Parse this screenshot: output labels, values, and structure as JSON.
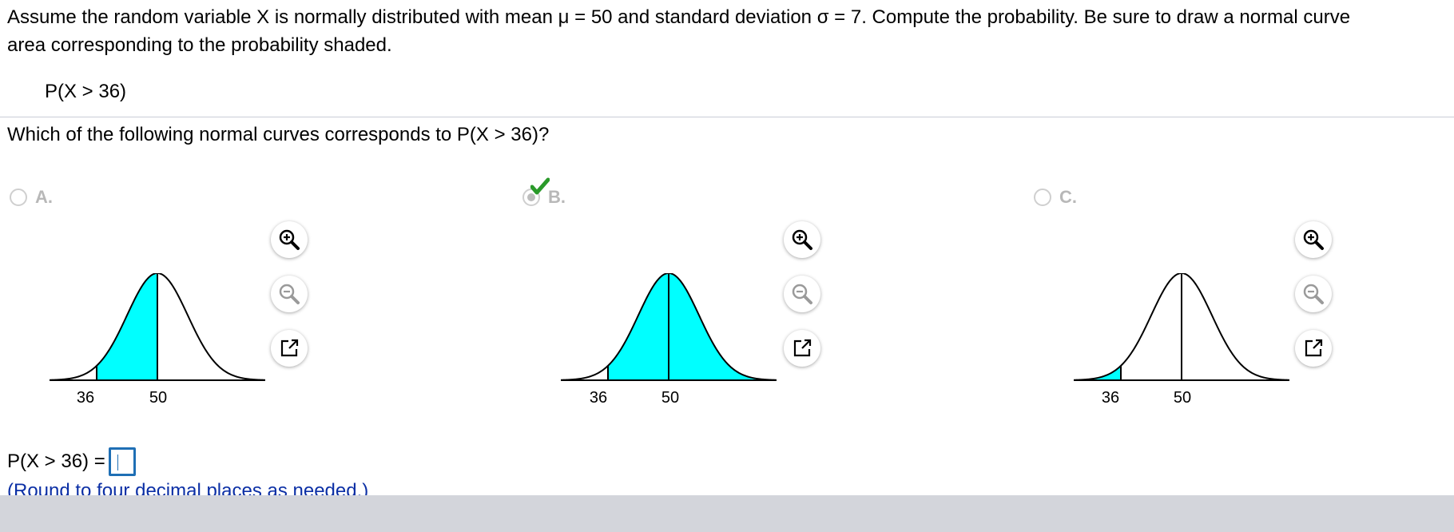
{
  "question": {
    "text_line1": "Assume the random variable X is normally distributed with mean μ = 50 and standard deviation σ = 7. Compute the probability. Be sure to draw a normal curve",
    "text_line2": "area corresponding to the probability shaded.",
    "expression": "P(X > 36)"
  },
  "prompt": "Which of the following normal curves corresponds to P(X > 36)?",
  "choices": [
    {
      "label": "A.",
      "selected": false,
      "shaded": "between 36 and 50",
      "ticks": [
        "36",
        "50"
      ]
    },
    {
      "label": "B.",
      "selected": true,
      "shaded": "right of 36",
      "ticks": [
        "36",
        "50"
      ]
    },
    {
      "label": "C.",
      "selected": false,
      "shaded": "left of 36",
      "ticks": [
        "36",
        "50"
      ]
    }
  ],
  "icons": [
    "zoom-in-icon",
    "zoom-out-icon",
    "popout-icon",
    "checkmark-icon"
  ],
  "answer": {
    "label": "P(X > 36) =",
    "value": "",
    "hint": "(Round to four decimal places as needed.)"
  },
  "colors": {
    "shade": "#00ffff",
    "checkmark": "#2a9a2a",
    "input_border": "#1f6fb5",
    "hint_text": "#0b2fa5"
  }
}
